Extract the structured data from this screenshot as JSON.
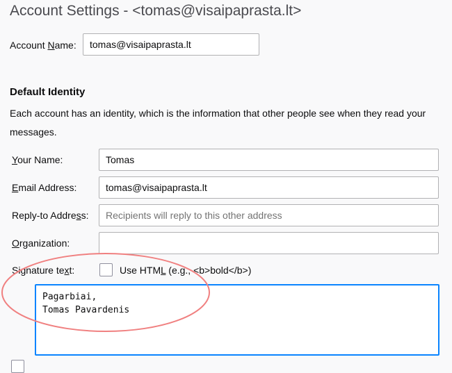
{
  "header": {
    "title": "Account Settings - <tomas@visaipaprasta.lt>"
  },
  "account": {
    "name_label_pre": "Account ",
    "name_label_key": "N",
    "name_label_post": "ame:",
    "name_value": "tomas@visaipaprasta.lt"
  },
  "identity": {
    "heading": "Default Identity",
    "description": "Each account has an identity, which is the information that other people see when they read your messages.",
    "your_name": {
      "key": "Y",
      "rest": "our Name:",
      "value": "Tomas"
    },
    "email": {
      "key": "E",
      "rest": "mail Address:",
      "value": "tomas@visaipaprasta.lt"
    },
    "reply_to": {
      "pre": "Reply-to Addre",
      "key": "s",
      "post": "s:",
      "placeholder": "Recipients will reply to this other address"
    },
    "organization": {
      "key": "O",
      "rest": "rganization:",
      "value": ""
    },
    "signature": {
      "label_pre": "Signature te",
      "label_key": "x",
      "label_post": "t:",
      "use_html_pre": "Use HTM",
      "use_html_key": "L",
      "use_html_post": " (e.g., <b>bold</b>)",
      "use_html_checked": false,
      "text": "Pagarbiai,\nTomas Pavardenis"
    }
  },
  "colors": {
    "focus": "#0a84ff",
    "annotation": "#f08080"
  }
}
